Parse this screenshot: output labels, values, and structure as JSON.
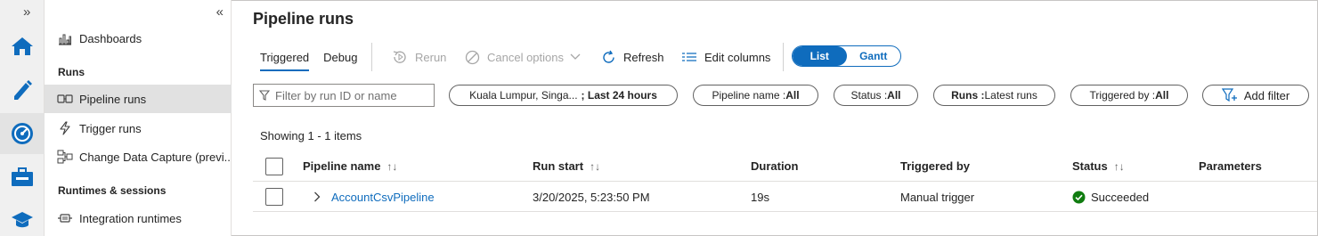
{
  "rail": {
    "expand_glyph": "»",
    "icons": [
      "home-icon",
      "author-pencil-icon",
      "monitor-gauge-icon",
      "manage-toolbox-icon",
      "learning-cap-icon"
    ]
  },
  "nav": {
    "collapse_glyph": "«",
    "dashboards": "Dashboards",
    "runs_section": "Runs",
    "pipeline_runs": "Pipeline runs",
    "trigger_runs": "Trigger runs",
    "change_data_capture": "Change Data Capture (previ...",
    "runtimes_section": "Runtimes & sessions",
    "integration_runtimes": "Integration runtimes"
  },
  "page": {
    "title": "Pipeline runs"
  },
  "tabs": {
    "triggered": "Triggered",
    "debug": "Debug"
  },
  "toolbar": {
    "rerun": "Rerun",
    "cancel_options": "Cancel options",
    "refresh": "Refresh",
    "edit_columns": "Edit columns",
    "view_list": "List",
    "view_gantt": "Gantt"
  },
  "filters": {
    "search_placeholder": "Filter by run ID or name",
    "timezone_prefix": "Kuala Lumpur, Singa...",
    "timezone_range": "; Last 24 hours",
    "pipeline_key": "Pipeline name : ",
    "pipeline_value": "All",
    "status_key": "Status : ",
    "status_value": "All",
    "runs_key": "Runs : ",
    "runs_value": "Latest runs",
    "triggered_key": "Triggered by : ",
    "triggered_value": "All",
    "add_filter": "Add filter"
  },
  "summary": "Showing 1 - 1 items",
  "table": {
    "columns": {
      "pipeline_name": "Pipeline name",
      "run_start": "Run start",
      "duration": "Duration",
      "triggered_by": "Triggered by",
      "status": "Status",
      "parameters": "Parameters"
    },
    "rows": [
      {
        "pipeline_name": "AccountCsvPipeline",
        "run_start": "3/20/2025, 5:23:50 PM",
        "duration": "19s",
        "triggered_by": "Manual trigger",
        "status": "Succeeded",
        "parameters": ""
      }
    ]
  },
  "colors": {
    "accent": "#0f6cbd",
    "success": "#107c10"
  }
}
